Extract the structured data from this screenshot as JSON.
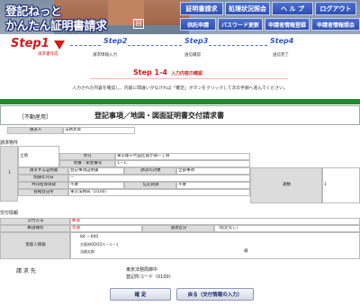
{
  "header": {
    "title_line1": "登記ねっと",
    "title_line2": "かんたん証明書請求",
    "title_badge": "回",
    "nav_top": [
      "証明書請求",
      "処理状況照会",
      "ヘ ル プ",
      "ログアウト"
    ],
    "nav_bottom": [
      "供託申請",
      "パスワード更新",
      "申請者情報登録",
      "申請者情報照会"
    ]
  },
  "steps": [
    {
      "no": "Step1",
      "desc": "請求書作成"
    },
    {
      "no": "Step2",
      "desc": "請求情報入力"
    },
    {
      "no": "Step3",
      "desc": "送信確認"
    },
    {
      "no": "Step4",
      "desc": "送信完了"
    }
  ],
  "page": {
    "title": "Step 1-4",
    "subtitle": "入力内容の確認",
    "instruction": "入力された内容を確認し、内容に間違いがなければ「確定」ボタンをクリックして次の手順へ進んでください。"
  },
  "form": {
    "kind": "［不動産用］",
    "title": "登記事項／地図・図面証明書交付請求書",
    "requester_label": "請求人",
    "requester_value": "法務太郎",
    "objects_label": "請求物件",
    "row_no": "1",
    "category": "土地",
    "location_label": "所在",
    "location_value": "東京都千代田区霞が関一丁目",
    "lot_label": "地番／家屋番号",
    "lot_value": "1－1",
    "cert_type_label": "請求する証明書",
    "cert_type_value": "登記事項証明書",
    "target_label": "請求の対象",
    "target_value": "全部事項",
    "closed_date_label": "閉鎖年月日",
    "closed_date_value": "－",
    "joint_label": "共同担保目録",
    "joint_value": "不要",
    "trust_label": "信託目録",
    "trust_value": "不要",
    "office_label": "管轄登記所",
    "office_value": "東京法務局（0100）",
    "copies_label": "通数",
    "copies_value": "1",
    "delivery_label": "交付情報",
    "method_label": "交付方法",
    "method_value": "郵送",
    "mail_label": "郵送種別",
    "mail_value": "普通",
    "express_label": "速達区分",
    "express_value": "（指定なし）",
    "recipient_label": "受取人情報",
    "recipient_zip": "84 －000",
    "recipient_addr": "大阪府OOOO１−１−１",
    "recipient_name": "法務太郎",
    "recipient_honor": "様",
    "dest_label": "請 求 先",
    "dest_line1": "東京法務局御中",
    "dest_line2": "登記所コード（0100）"
  },
  "buttons": {
    "confirm": "確 定",
    "back": "戻る（交付情報の入力）"
  }
}
